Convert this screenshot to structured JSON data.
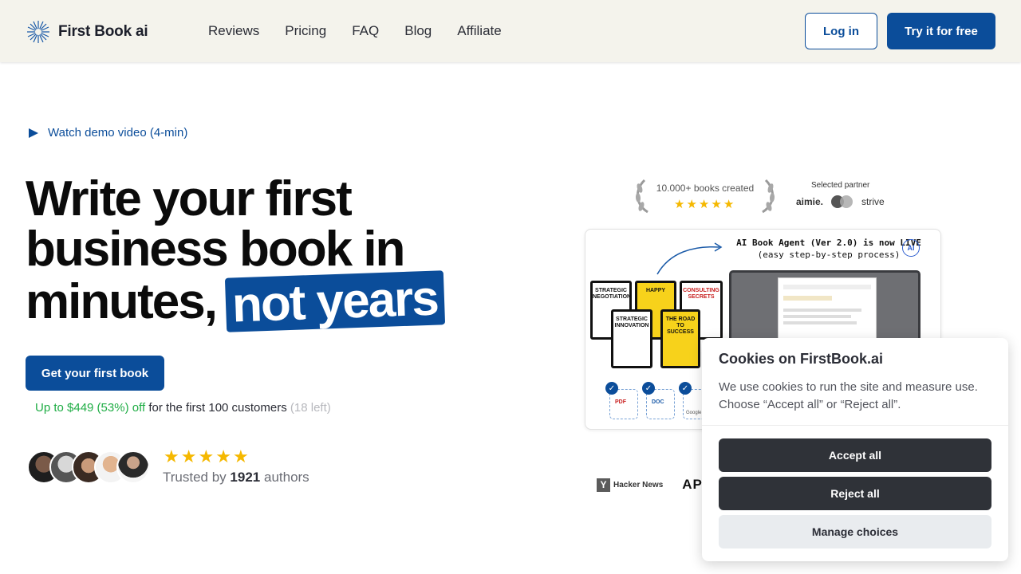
{
  "nav": {
    "brand": "First Book ai",
    "links": [
      "Reviews",
      "Pricing",
      "FAQ",
      "Blog",
      "Affiliate"
    ],
    "login": "Log in",
    "try_free": "Try it for free"
  },
  "hero": {
    "demo_link": "Watch demo video (4-min)",
    "headline_line1": "Write your first",
    "headline_line2": "business book in",
    "headline_line3": "minutes,",
    "headline_highlight": "not years",
    "cta": "Get your first book",
    "offer_discount": "Up to $449 (53%) off",
    "offer_text": "for the first 100 customers",
    "offer_left": "(18 left)",
    "trusted_prefix": "Trusted by",
    "trusted_count": "1921",
    "trusted_suffix": "authors",
    "rating_stars": 5
  },
  "social_proof": {
    "books_created": "10.000+ books created",
    "partner_label": "Selected partner",
    "partners": [
      "aimie.",
      "strive"
    ]
  },
  "agent_card": {
    "title": "AI Book Agent (Ver 2.0) is now LIVE",
    "subtitle": "(easy step-by-step process)",
    "badge": "AI",
    "books": [
      "STRATEGIC NEGOTIATION",
      "HAPPY",
      "CONSULTING SECRETS",
      "STRATEGIC INNOVATION",
      "THE ROAD TO SUCCESS"
    ],
    "file_types": [
      "PDF",
      "DOC",
      "Google"
    ]
  },
  "press": {
    "hn_letter": "Y",
    "hn_label": "Hacker News",
    "ap": "AP"
  },
  "cookie": {
    "title": "Cookies on FirstBook.ai",
    "body": "We use cookies to run the site and measure use. Choose “Accept all” or “Reject all”.",
    "accept": "Accept all",
    "reject": "Reject all",
    "manage": "Manage choices"
  },
  "colors": {
    "brand_blue": "#0b4d9a",
    "nav_bg": "#f4f3ec",
    "star": "#f5b800",
    "offer_green": "#1fad45"
  }
}
